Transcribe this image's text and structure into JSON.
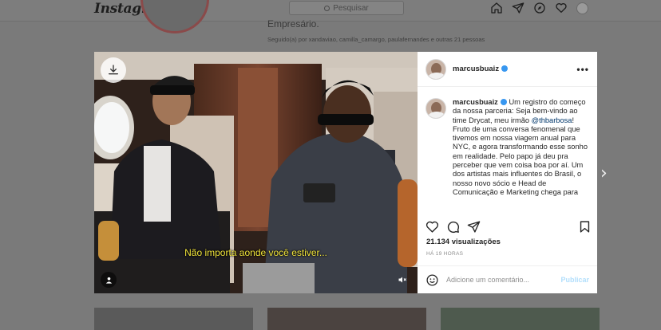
{
  "app": {
    "logo_text": "Instagram"
  },
  "topbar": {
    "search_placeholder": "Pesquisar",
    "nav_icons": [
      "home-icon",
      "direct-icon",
      "explore-icon",
      "activity-heart-icon",
      "profile-avatar"
    ]
  },
  "background_profile": {
    "bio_fragment": "Empresário.",
    "followed_by": "Seguido(a) por xandaviao, camilla_camargo, paulafernandes e outras 21 pessoas"
  },
  "post": {
    "username": "marcusbuaiz",
    "verified": true,
    "more_label": "•••",
    "subtitle": "Não importa aonde você estiver...",
    "caption": {
      "username": "marcusbuaiz",
      "before_mention": "Um registro do começo da nossa parceria: Seja bem-vindo ao time Drycat, meu irmão ",
      "mention": "@thbarbosa",
      "after_mention": "! Fruto de uma conversa fenomenal que tivemos em nossa viagem anual para NYC, e agora transformando esse sonho em realidade. Pelo papo já deu pra perceber que vem coisa boa por aí. Um dos artistas mais influentes do Brasil, o nosso novo sócio e Head de Comunicação e Marketing chega para"
    },
    "views": "21.134 visualizações",
    "time": "HÁ 19 HORAS",
    "comment_placeholder": "Adicione um comentário...",
    "post_label": "Publicar"
  },
  "colors": {
    "link_blue": "#00376b",
    "verified_blue": "#3897f0",
    "subtitle_yellow": "#f1e43a"
  }
}
